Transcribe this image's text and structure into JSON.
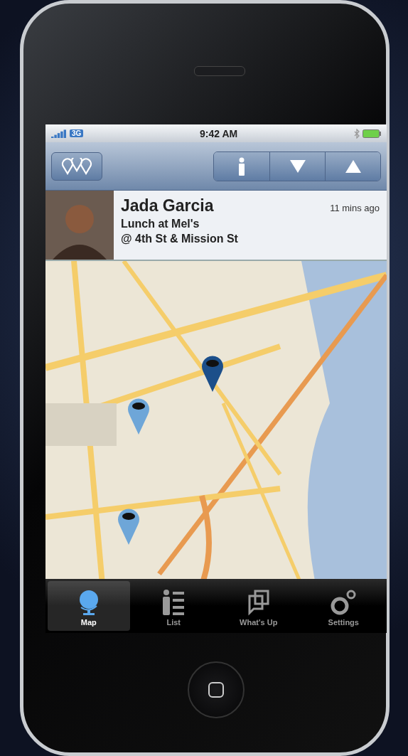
{
  "status_bar": {
    "network": "3G",
    "time": "9:42 AM"
  },
  "toolbar": {
    "buttons": [
      {
        "kind": "info"
      },
      {
        "kind": "down"
      },
      {
        "kind": "up"
      }
    ]
  },
  "callout": {
    "name": "Jada Garcia",
    "time": "11 mins ago",
    "activity": "Lunch at Mel's",
    "location": "@ 4th St & Mission St"
  },
  "map": {
    "pins": [
      {
        "selected": true
      },
      {
        "selected": false
      },
      {
        "selected": false
      }
    ]
  },
  "tabs": [
    {
      "label": "Map",
      "kind": "globe",
      "selected": true
    },
    {
      "label": "List",
      "kind": "list",
      "selected": false
    },
    {
      "label": "What's Up",
      "kind": "whatsup",
      "selected": false
    },
    {
      "label": "Settings",
      "kind": "gears",
      "selected": false
    }
  ]
}
